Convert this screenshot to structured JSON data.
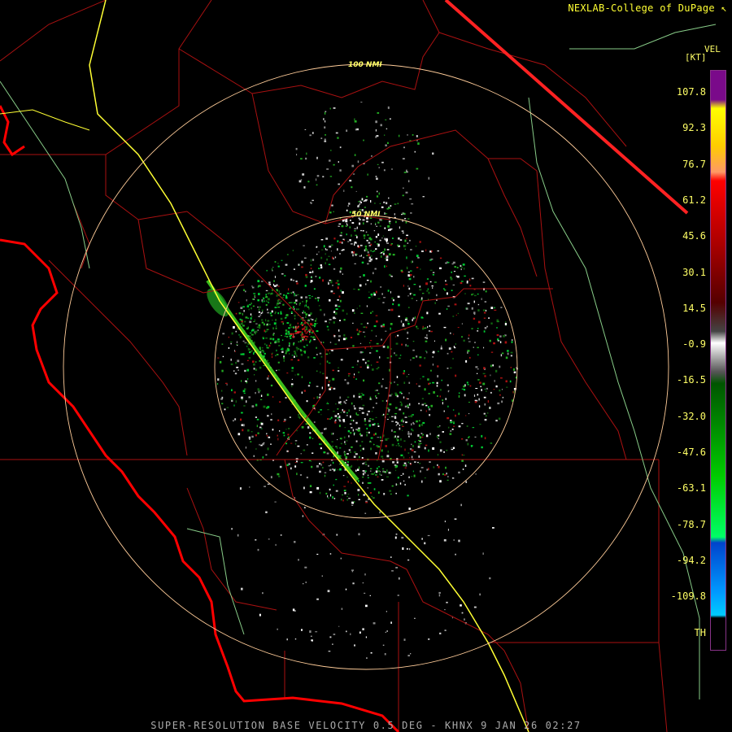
{
  "header": {
    "brand": "NEXLAB-College of DuPage"
  },
  "legend": {
    "product_code": "VEL",
    "units": "[KT]",
    "ticks": [
      "107.8",
      "92.3",
      "76.7",
      "61.2",
      "45.6",
      "30.1",
      "14.5",
      "-0.9",
      "-16.5",
      "-32.0",
      "-47.6",
      "-63.1",
      "-78.7",
      "-94.2",
      "-109.8",
      "TH"
    ],
    "colorbar_stops": [
      {
        "pct": 0,
        "color": "#7a0a8a"
      },
      {
        "pct": 5,
        "color": "#7a0a8a"
      },
      {
        "pct": 6.5,
        "color": "#ffff00"
      },
      {
        "pct": 13,
        "color": "#ffcc00"
      },
      {
        "pct": 17.5,
        "color": "#ff9966"
      },
      {
        "pct": 19,
        "color": "#ff0000"
      },
      {
        "pct": 30,
        "color": "#aa0000"
      },
      {
        "pct": 40,
        "color": "#550000"
      },
      {
        "pct": 45,
        "color": "#444444"
      },
      {
        "pct": 47,
        "color": "#ffffff"
      },
      {
        "pct": 52,
        "color": "#555555"
      },
      {
        "pct": 54,
        "color": "#005500"
      },
      {
        "pct": 70,
        "color": "#00cc00"
      },
      {
        "pct": 80.5,
        "color": "#00ff66"
      },
      {
        "pct": 81.5,
        "color": "#0044cc"
      },
      {
        "pct": 90,
        "color": "#0099ff"
      },
      {
        "pct": 94,
        "color": "#00ccff"
      },
      {
        "pct": 94.5,
        "color": "#000000"
      },
      {
        "pct": 100,
        "color": "#000000"
      }
    ]
  },
  "rings": {
    "inner_label": "50 NMI",
    "outer_label": "100 NMI"
  },
  "footer": {
    "caption": "SUPER-RESOLUTION BASE VELOCITY 0.5 DEG - KHNX 9 JAN 26 02:27"
  },
  "colors": {
    "county_lines": "#aa1111",
    "state_line": "#ff2222",
    "coastline": "#ff0000",
    "highway": "#ffff33",
    "river": "#88cc88",
    "range_rings": "#ffcc99",
    "background": "#000000"
  },
  "icons": {
    "brand_icon": "cursor-arrow-icon"
  }
}
